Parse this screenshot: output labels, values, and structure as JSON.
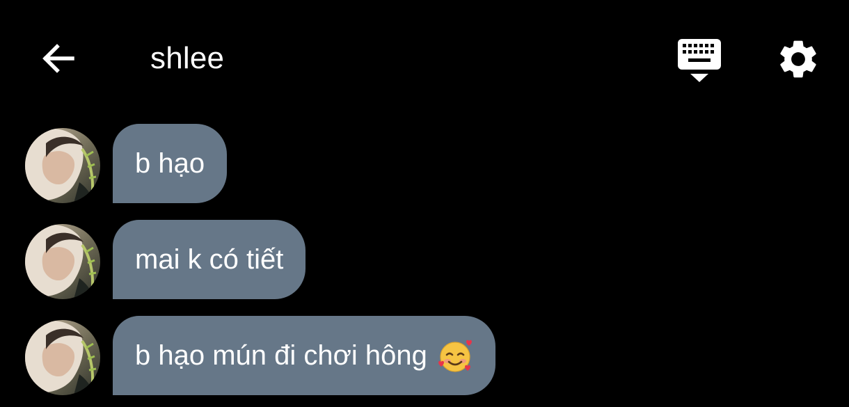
{
  "header": {
    "title": "shlee",
    "back_icon": "arrow-left-icon",
    "keyboard_icon": "keyboard-icon",
    "settings_icon": "gear-icon"
  },
  "messages": [
    {
      "text": "b hạo",
      "emoji": null
    },
    {
      "text": "mai k có tiết",
      "emoji": null
    },
    {
      "text": "b hạo mún đi chơi hông",
      "emoji": "smiling-face-with-hearts"
    }
  ],
  "colors": {
    "background": "#000000",
    "bubble": "#667788",
    "text": "#ffffff"
  }
}
